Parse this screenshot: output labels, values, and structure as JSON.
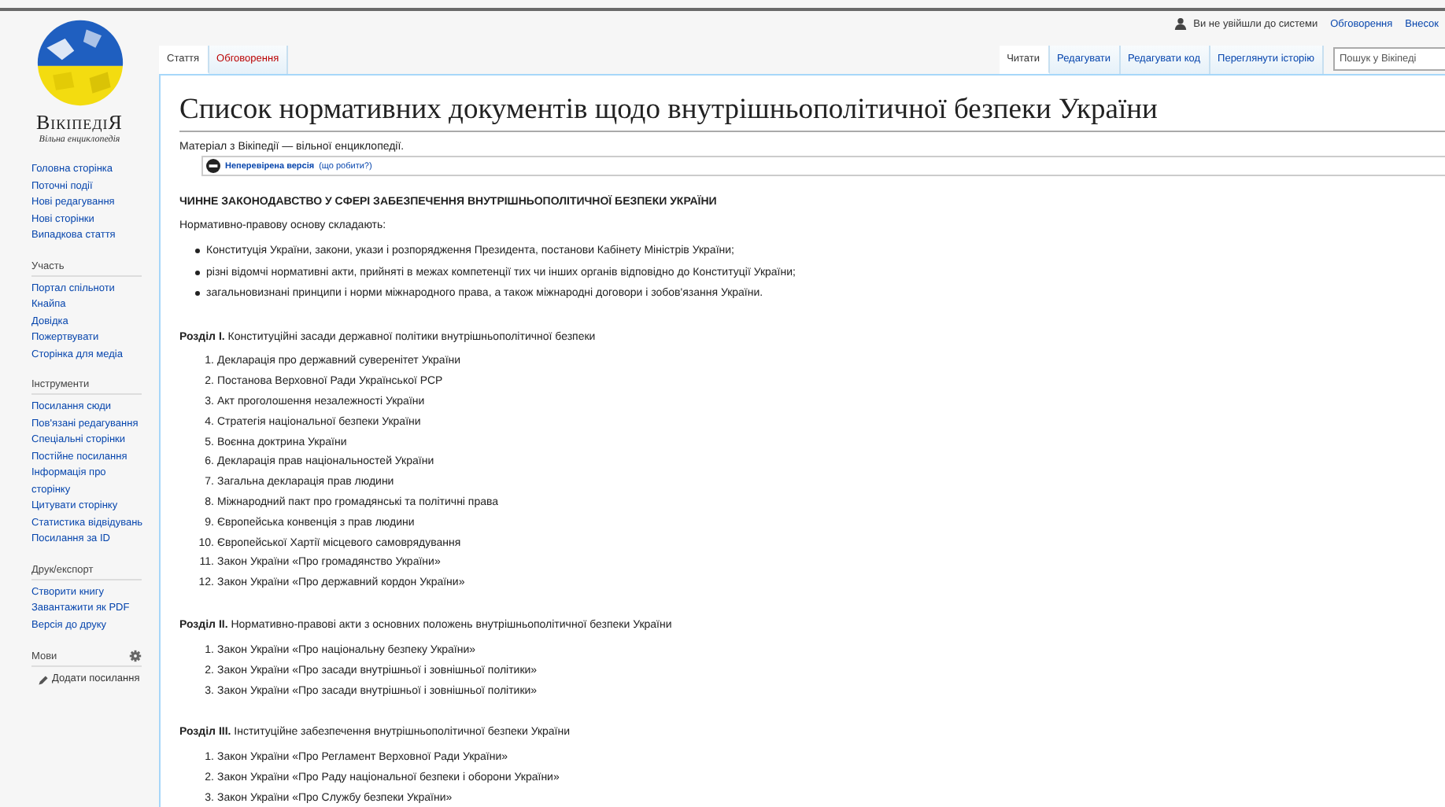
{
  "personal": {
    "user": "Ви не увійшли до системи",
    "links": [
      "Обговорення",
      "Внесок"
    ]
  },
  "logo": {
    "name": "ВікіпедіЯ",
    "tagline": "Вільна енциклопедія"
  },
  "sidebar": [
    {
      "kind": "links",
      "items": [
        "Головна сторінка",
        "Поточні події",
        "Нові редагування",
        "Нові сторінки",
        "Випадкова стаття"
      ]
    },
    {
      "kind": "links",
      "heading": "Участь",
      "items": [
        "Портал спільноти",
        "Кнайпа",
        "Довідка",
        "Пожертвувати",
        "Сторінка для медіа"
      ]
    },
    {
      "kind": "links",
      "heading": "Інструменти",
      "items": [
        "Посилання сюди",
        "Пов'язані редагування",
        "Спеціальні сторінки",
        "Постійне посилання",
        "Інформація про сторінку",
        "Цитувати сторінку",
        "Статистика відвідувань",
        "Посилання за ID"
      ]
    },
    {
      "kind": "links",
      "heading": "Друк/експорт",
      "items": [
        "Створити книгу",
        "Завантажити як PDF",
        "Версія до друку"
      ]
    },
    {
      "kind": "languages",
      "heading": "Мови",
      "items": [
        "Додати посилання"
      ]
    }
  ],
  "left_tabs": [
    {
      "label": "Стаття",
      "selected": true,
      "new": false
    },
    {
      "label": "Обговорення",
      "selected": false,
      "new": true
    }
  ],
  "right_tabs": [
    {
      "label": "Читати",
      "selected": true
    },
    {
      "label": "Редагувати",
      "selected": false
    },
    {
      "label": "Редагувати код",
      "selected": false
    },
    {
      "label": "Переглянути історію",
      "selected": false
    }
  ],
  "search": {
    "placeholder": "Пошук у Вікіпеді"
  },
  "article": {
    "title": "Список нормативних документів щодо внутрішньополітичної безпеки України",
    "tagline": "Матеріал з Вікіпедії — вільної енциклопедії.",
    "review": {
      "status": "Неперевірена версія",
      "link": "(що робити?)"
    },
    "heading": "ЧИННЕ ЗАКОНОДАВСТВО У СФЕРІ ЗАБЕЗПЕЧЕННЯ ВНУТРІШНЬОПОЛІТИЧНОЇ БЕЗПЕКИ УКРАЇНИ",
    "intro": "Нормативно-правову основу складають:",
    "bullets": [
      "Конституція України, закони, укази і розпорядження Президента, постанови Кабінету Міністрів України;",
      "різні відомчі нормативні акти, прийняті в межах компетенції тих чи інших органів відповідно до Конституції України;",
      "загальновизнані принципи і норми міжнародного права, а також міжнародні договори і зобов'язання України."
    ],
    "sections": [
      {
        "title": "**Розділ I.** Конституційні засади державної політики внутрішньополітичної безпеки",
        "items": [
          {
            "number": "1.",
            "text": "Декларація про державний суверенітет України"
          },
          {
            "number": "2.",
            "text": "Постанова Верховної Ради Української РСР"
          },
          {
            "number": "3.",
            "text": "Акт проголошення незалежності України"
          },
          {
            "number": "4.",
            "text": "Стратегія національної безпеки України"
          },
          {
            "number": "5.",
            "text": "Воєнна доктрина України"
          },
          {
            "number": "6.",
            "text": "Декларація прав національностей України"
          },
          {
            "number": "7.",
            "text": "Загальна декларація прав людини"
          },
          {
            "number": "8.",
            "text": "Міжнародний пакт про громадянські та політичні права"
          },
          {
            "number": "9.",
            "text": "Європейська конвенція з прав людини"
          },
          {
            "number": "10.",
            "text": "Європейської Хартії місцевого самоврядування"
          },
          {
            "number": "11.",
            "text": "Закон України «Про громадянство України»"
          },
          {
            "number": "12.",
            "text": "Закон України «Про державний кордон України»"
          }
        ]
      },
      {
        "title": "**Розділ II.** Нормативно-правові акти з основних положень внутрішньополітичної безпеки України",
        "items": [
          {
            "number": "1.",
            "text": "Закон України «Про національну безпеку України»"
          },
          {
            "number": "2.",
            "text": "Закон України «Про засади внутрішньої і зовнішньої політики»"
          },
          {
            "number": "3.",
            "text": "Закон України «Про засади внутрішньої і зовнішньої політики»"
          }
        ]
      },
      {
        "title": "**Розділ III.** Інституційне забезпечення внутрішньополітичної безпеки України",
        "items": [
          {
            "number": "1.",
            "text": "Закон України «Про Регламент Верховної Ради України»"
          },
          {
            "number": "2.",
            "text": "Закон України «Про Раду національної безпеки і оборони України»"
          },
          {
            "number": "3.",
            "text": "Закон України «Про Службу безпеки України»"
          }
        ]
      }
    ]
  }
}
